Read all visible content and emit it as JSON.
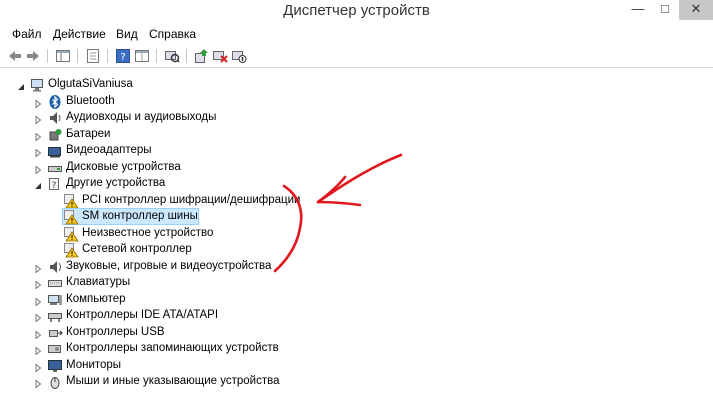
{
  "window": {
    "title": "Диспетчер устройств",
    "minimize_glyph": "—",
    "maximize_glyph": "□",
    "close_glyph": "✕"
  },
  "menu": {
    "items": [
      "Файл",
      "Действие",
      "Вид",
      "Справка"
    ]
  },
  "toolbar": {
    "buttons": [
      "back-icon",
      "forward-icon",
      "console-tree-icon",
      "properties-icon",
      "help-icon",
      "view-icon",
      "scan-hardware-icon",
      "update-driver-icon",
      "uninstall-icon",
      "disable-icon"
    ]
  },
  "tree": {
    "root": "OlgutaSiVaniusa",
    "items": [
      {
        "label": "Bluetooth",
        "icon": "bluetooth-icon",
        "expanded": false
      },
      {
        "label": "Аудиовходы и аудиовыходы",
        "icon": "speaker-icon",
        "expanded": false
      },
      {
        "label": "Батареи",
        "icon": "battery-icon",
        "expanded": false
      },
      {
        "label": "Видеоадаптеры",
        "icon": "display-adapter-icon",
        "expanded": false
      },
      {
        "label": "Дисковые устройства",
        "icon": "disk-drive-icon",
        "expanded": false
      },
      {
        "label": "Другие устройства",
        "icon": "other-devices-icon",
        "expanded": true
      },
      {
        "label": "PCI контроллер шифрации/дешифрации",
        "icon": "warning-device-icon",
        "child": true
      },
      {
        "label": "SM контроллер шины",
        "icon": "warning-device-icon",
        "child": true,
        "selected": true
      },
      {
        "label": "Неизвестное устройство",
        "icon": "warning-device-icon",
        "child": true
      },
      {
        "label": "Сетевой контроллер",
        "icon": "warning-device-icon",
        "child": true
      },
      {
        "label": "Звуковые, игровые и видеоустройства",
        "icon": "sound-icon",
        "expanded": false
      },
      {
        "label": "Клавиатуры",
        "icon": "keyboard-icon",
        "expanded": false
      },
      {
        "label": "Компьютер",
        "icon": "computer-icon",
        "expanded": false
      },
      {
        "label": "Контроллеры IDE ATA/ATAPI",
        "icon": "ide-controller-icon",
        "expanded": false
      },
      {
        "label": "Контроллеры USB",
        "icon": "usb-icon",
        "expanded": false
      },
      {
        "label": "Контроллеры запоминающих устройств",
        "icon": "storage-controller-icon",
        "expanded": false
      },
      {
        "label": "Мониторы",
        "icon": "monitor-icon",
        "expanded": false
      },
      {
        "label": "Мыши и иные указывающие устройства",
        "icon": "mouse-icon",
        "expanded": false
      }
    ]
  },
  "colors": {
    "selection_bg": "#cce8ff",
    "annotation_red": "#e0171d",
    "warning_yellow": "#f5c518"
  }
}
